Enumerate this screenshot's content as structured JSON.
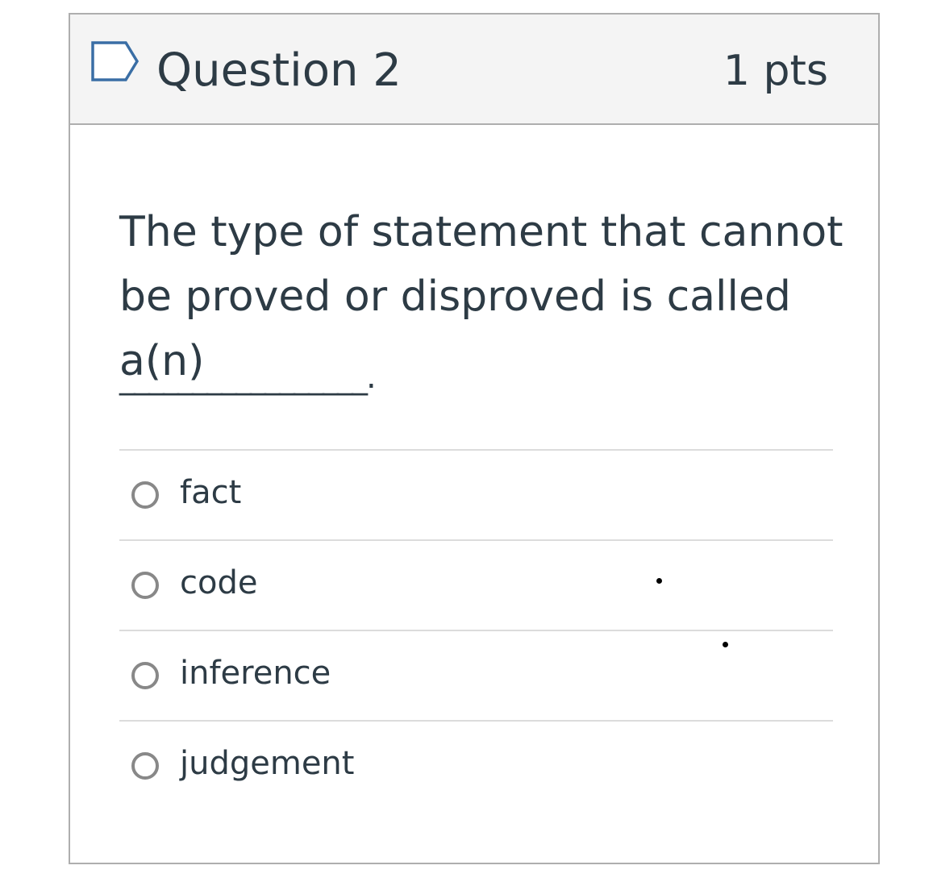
{
  "question": {
    "title": "Question 2",
    "points": "1 pts",
    "text": "The type of statement that cannot be proved or disproved is called a(n)",
    "blank": "_________________."
  },
  "icons": {
    "flag": "flag-outline-icon",
    "radio": "radio-unchecked-icon"
  },
  "answers": [
    {
      "label": "fact"
    },
    {
      "label": "code"
    },
    {
      "label": "inference"
    },
    {
      "label": "judgement"
    }
  ],
  "colors": {
    "text": "#2d3b45",
    "flag": "#3a6ea5",
    "border": "#aeaeae",
    "header_bg": "#f4f4f4"
  }
}
